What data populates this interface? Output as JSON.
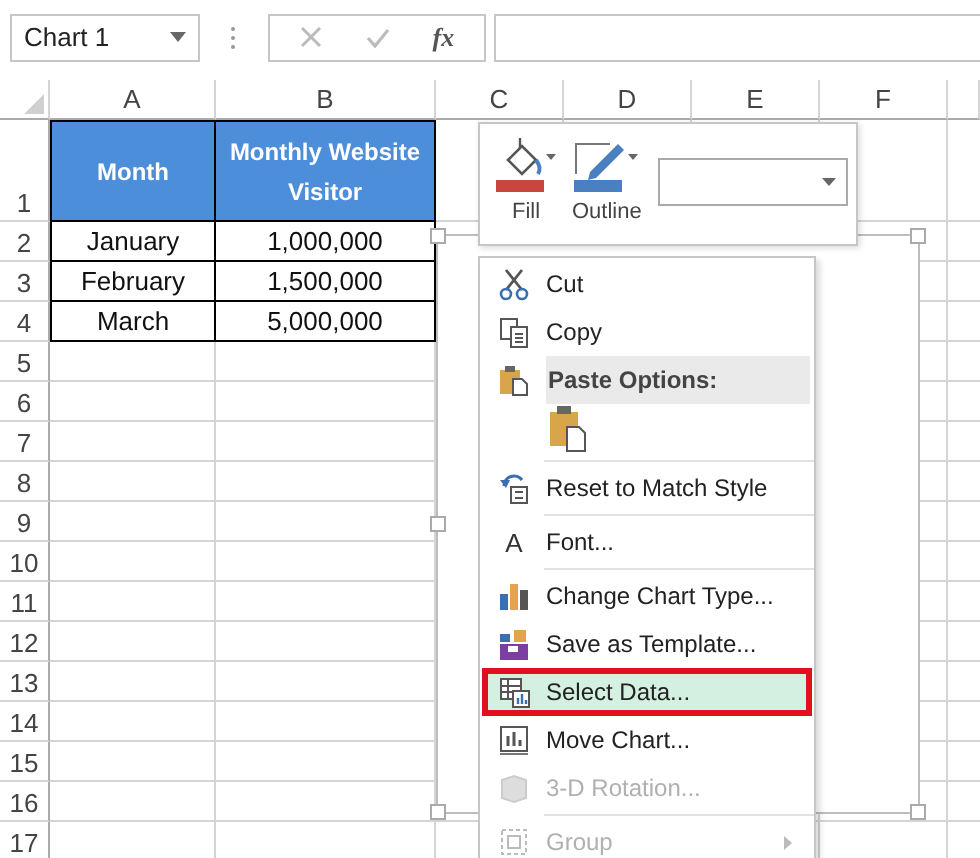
{
  "name_box": {
    "value": "Chart 1"
  },
  "formula_bar": {
    "function_label": "fx"
  },
  "sheet": {
    "columns": [
      "A",
      "B",
      "C",
      "D",
      "E",
      "F"
    ],
    "rows": [
      {
        "label": "1",
        "kind": "header",
        "cells": [
          "Month",
          "Monthly Website Visitor"
        ]
      },
      {
        "label": "2",
        "kind": "data",
        "cells": [
          "January",
          "1,000,000"
        ]
      },
      {
        "label": "3",
        "kind": "data",
        "cells": [
          "February",
          "1,500,000"
        ]
      },
      {
        "label": "4",
        "kind": "data",
        "cells": [
          "March",
          "5,000,000"
        ]
      },
      {
        "label": "5"
      },
      {
        "label": "6"
      },
      {
        "label": "7"
      },
      {
        "label": "8"
      },
      {
        "label": "9"
      },
      {
        "label": "10"
      },
      {
        "label": "11"
      },
      {
        "label": "12"
      },
      {
        "label": "13"
      },
      {
        "label": "14"
      },
      {
        "label": "15"
      },
      {
        "label": "16"
      },
      {
        "label": "17"
      }
    ]
  },
  "mini_toolbar": {
    "buttons": [
      {
        "label": "Fill",
        "color": "#c9463d"
      },
      {
        "label": "Outline",
        "color": "#4a7fc1"
      }
    ]
  },
  "context_menu": {
    "items": [
      {
        "kind": "item",
        "label": "Cut",
        "selected": false,
        "disabled": false
      },
      {
        "kind": "item",
        "label": "Copy",
        "selected": false,
        "disabled": false
      },
      {
        "kind": "header",
        "label": "Paste Options:"
      },
      {
        "kind": "paste"
      },
      {
        "kind": "separator"
      },
      {
        "kind": "item",
        "label": "Reset to Match Style",
        "selected": false,
        "disabled": false
      },
      {
        "kind": "separator"
      },
      {
        "kind": "item",
        "label": "Font...",
        "glyph": "A",
        "selected": false,
        "disabled": false
      },
      {
        "kind": "separator"
      },
      {
        "kind": "item",
        "label": "Change Chart Type...",
        "selected": false,
        "disabled": false
      },
      {
        "kind": "item",
        "label": "Save as Template...",
        "selected": false,
        "disabled": false
      },
      {
        "kind": "item",
        "label": "Select Data...",
        "selected": true,
        "disabled": false
      },
      {
        "kind": "item",
        "label": "Move Chart...",
        "selected": false,
        "disabled": false
      },
      {
        "kind": "item",
        "label": "3-D Rotation...",
        "selected": false,
        "disabled": true
      },
      {
        "kind": "separator"
      },
      {
        "kind": "item",
        "label": "Group",
        "selected": false,
        "disabled": true,
        "submenu": true
      }
    ]
  }
}
